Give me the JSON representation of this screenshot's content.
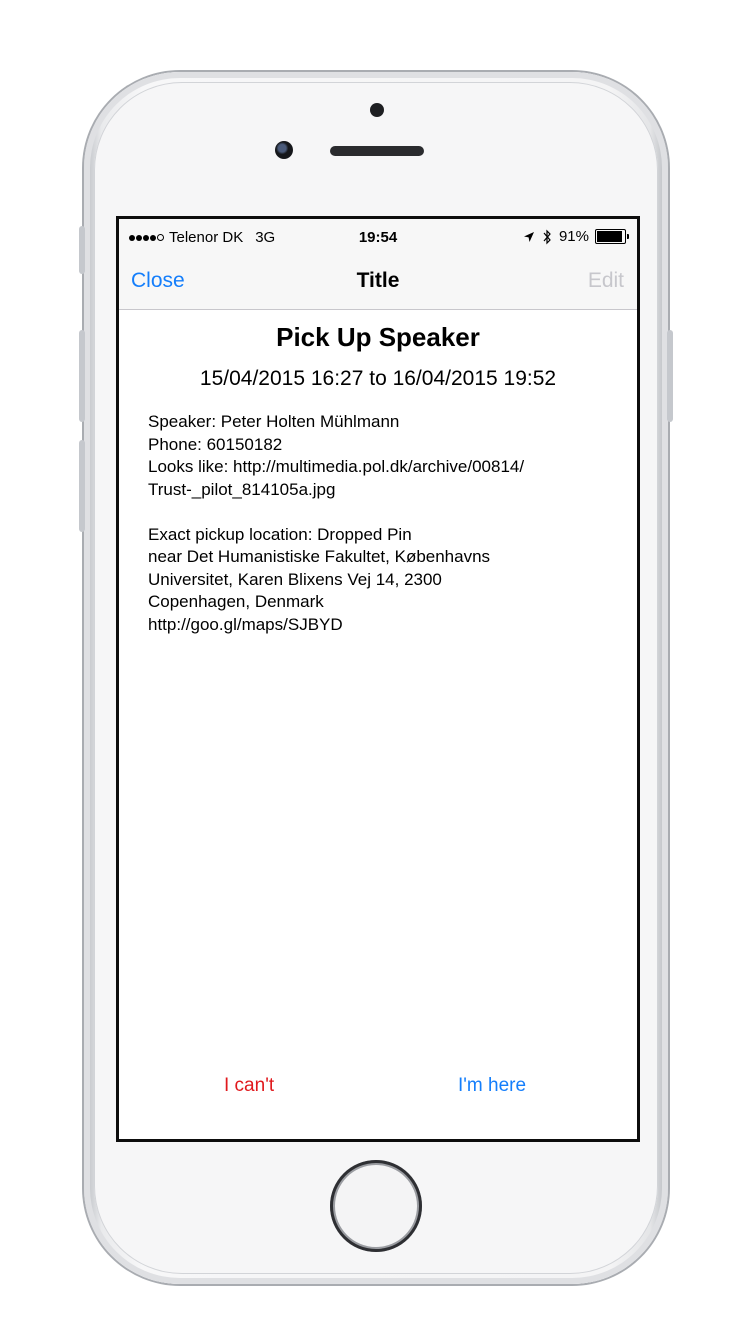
{
  "status_bar": {
    "carrier": "Telenor DK",
    "network": "3G",
    "time": "19:54",
    "battery_percent": "91%",
    "battery_level": 0.91,
    "icons": [
      "location-arrow-icon",
      "bluetooth-icon",
      "battery-icon"
    ]
  },
  "nav": {
    "close_label": "Close",
    "title": "Title",
    "edit_label": "Edit"
  },
  "event": {
    "title": "Pick Up Speaker",
    "date_range": "15/04/2015 16:27 to 16/04/2015 19:52",
    "details": {
      "speaker": "Speaker: Peter Holten Mühlmann",
      "phone": "Phone: 60150182",
      "looks_like_1": "Looks like: http://multimedia.pol.dk/archive/00814/",
      "looks_like_2": "Trust-_pilot_814105a.jpg",
      "location_1": "Exact pickup location: Dropped Pin",
      "location_2": "near Det Humanistiske Fakultet, Københavns",
      "location_3": "Universitet, Karen Blixens Vej 14, 2300",
      "location_4": "Copenhagen, Denmark",
      "location_5": "http://goo.gl/maps/SJBYD"
    }
  },
  "actions": {
    "cant_label": "I can't",
    "here_label": "I'm here"
  },
  "colors": {
    "accent_blue": "#147efb",
    "destructive_red": "#e0191d",
    "disabled_gray": "#c7c7cc"
  }
}
